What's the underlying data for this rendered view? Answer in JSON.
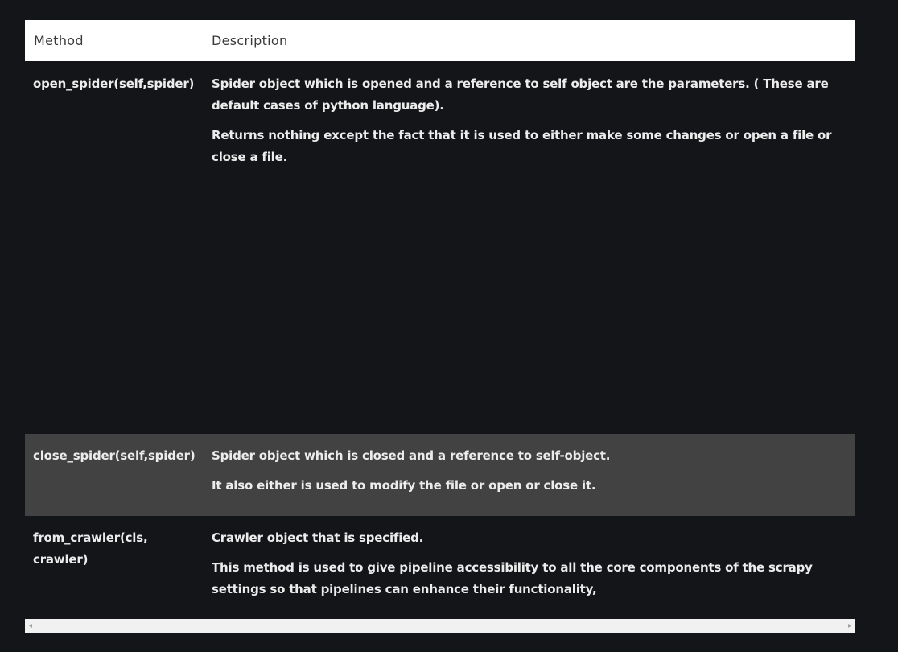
{
  "table": {
    "headers": {
      "method": "Method",
      "description": "Description"
    },
    "rows": [
      {
        "method": "open_spider(self,spider)",
        "description": [
          "Spider object which is opened and a reference to self object are the parameters.  ( These are default cases of python language).",
          "Returns nothing except the fact that it is used to either make some changes or open a file or close a file."
        ]
      },
      {
        "method": "close_spider(self,spider)",
        "description": [
          "Spider object which is  closed and a reference to self-object.",
          "It also either is used to modify the file or open or close it."
        ]
      },
      {
        "method": "from_crawler(cls, crawler)",
        "description": [
          "Crawler object that is specified.",
          "This method is used to give pipeline accessibility to all the core components of the scrapy settings so that pipelines can enhance their functionality,"
        ]
      }
    ]
  },
  "scrollbar": {
    "left_icon": "scroll-left-arrow-icon",
    "right_icon": "scroll-right-arrow-icon"
  },
  "colors": {
    "background": "#141519",
    "header_bg": "#ffffff",
    "highlight_row_bg": "#424242",
    "text": "#ececec"
  }
}
